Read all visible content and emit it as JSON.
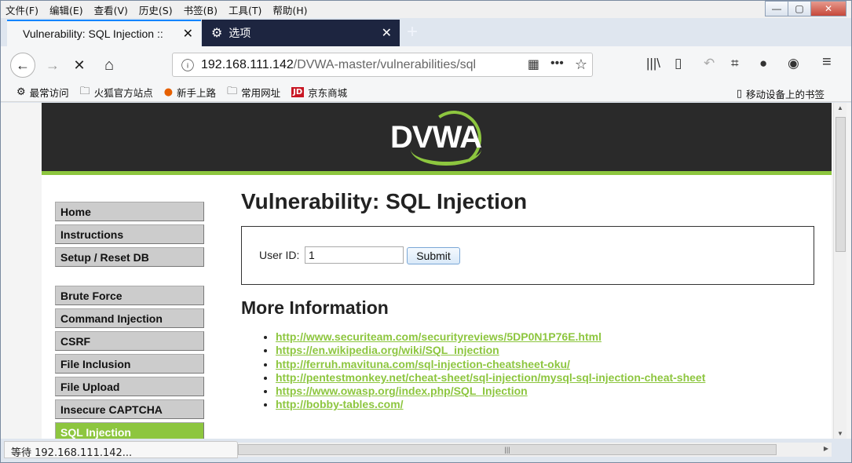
{
  "menubar": [
    "文件(F)",
    "编辑(E)",
    "查看(V)",
    "历史(S)",
    "书签(B)",
    "工具(T)",
    "帮助(H)"
  ],
  "window_controls": {
    "min": "—",
    "max": "▢",
    "close": "✕"
  },
  "tabs": [
    {
      "title": "Vulnerability: SQL Injection ::",
      "close": "✕"
    },
    {
      "title": "选项",
      "close": "✕"
    }
  ],
  "new_tab": "+",
  "nav": {
    "back": "←",
    "forward": "→",
    "stop": "✕",
    "home": "⌂"
  },
  "url": {
    "host": "192.168.111.142",
    "path": "/DVWA-master/vulnerabilities/sql"
  },
  "url_icons": {
    "qr": "▦",
    "more": "•••",
    "star": "☆"
  },
  "toolbar_icons": {
    "library": "|||\\",
    "sidebar": "▯",
    "undo": "↶",
    "crop": "⌗",
    "chat": "●",
    "account": "◉",
    "menu": "≡"
  },
  "bookmarks": [
    {
      "label": "最常访问",
      "icon": "gear-icon"
    },
    {
      "label": "火狐官方站点",
      "icon": "folder-icon"
    },
    {
      "label": "新手上路",
      "icon": "firefox-icon"
    },
    {
      "label": "常用网址",
      "icon": "folder-icon"
    },
    {
      "label": "京东商城",
      "icon": "jd-icon",
      "badge": "JD"
    }
  ],
  "bookmarks_right": "移动设备上的书签",
  "dvwa": {
    "logo": "DVWA",
    "menu": {
      "group1": [
        "Home",
        "Instructions",
        "Setup / Reset DB"
      ],
      "group2": [
        "Brute Force",
        "Command Injection",
        "CSRF",
        "File Inclusion",
        "File Upload",
        "Insecure CAPTCHA",
        "SQL Injection"
      ]
    },
    "title": "Vulnerability: SQL Injection",
    "form": {
      "label": "User ID:",
      "value": "1",
      "submit": "Submit"
    },
    "more_info": "More Information",
    "links": [
      "http://www.securiteam.com/securityreviews/5DP0N1P76E.html",
      "https://en.wikipedia.org/wiki/SQL_injection",
      "http://ferruh.mavituna.com/sql-injection-cheatsheet-oku/",
      "http://pentestmonkey.net/cheat-sheet/sql-injection/mysql-sql-injection-cheat-sheet",
      "https://www.owasp.org/index.php/SQL_Injection",
      "http://bobby-tables.com/"
    ]
  },
  "status": "等待 192.168.111.142...",
  "colors": {
    "accent": "#8dc63f",
    "header": "#2a2a2a",
    "tab_focus": "#0a84ff"
  }
}
